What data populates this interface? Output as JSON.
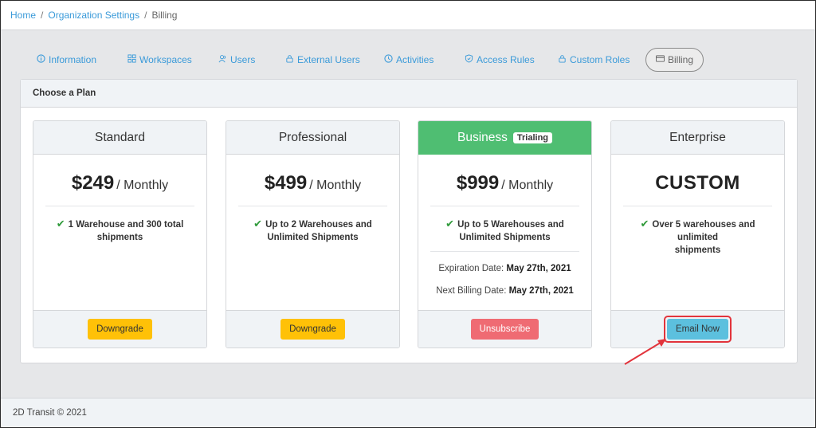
{
  "breadcrumb": {
    "items": [
      "Home",
      "Organization Settings"
    ],
    "separator": "/",
    "current": "Billing"
  },
  "tabs": [
    {
      "label": "Information",
      "icon": "info-icon"
    },
    {
      "label": "Workspaces",
      "icon": "grid-icon"
    },
    {
      "label": "Users",
      "icon": "users-icon"
    },
    {
      "label": "External Users",
      "icon": "lock-icon"
    },
    {
      "label": "Activities",
      "icon": "clock-icon"
    },
    {
      "label": "Access Rules",
      "icon": "shield-icon"
    },
    {
      "label": "Custom Roles",
      "icon": "lock-icon"
    },
    {
      "label": "Billing",
      "icon": "credit-card-icon",
      "active": true
    }
  ],
  "panel": {
    "title": "Choose a Plan"
  },
  "plans": [
    {
      "name": "Standard",
      "price": "$249",
      "period": "/ Monthly",
      "feature_line1": "1 Warehouse and 300 total",
      "feature_line2": "shipments",
      "button": "Downgrade"
    },
    {
      "name": "Professional",
      "price": "$499",
      "period": "/ Monthly",
      "feature_line1": "Up to 2 Warehouses and",
      "feature_line2": "Unlimited Shipments",
      "button": "Downgrade"
    },
    {
      "name": "Business",
      "badge": "Trialing",
      "price": "$999",
      "period": "/ Monthly",
      "feature_line1": "Up to 5 Warehouses and",
      "feature_line2": "Unlimited Shipments",
      "expiration_label": "Expiration Date:",
      "expiration_value": "May 27th, 2021",
      "next_billing_label": "Next Billing Date:",
      "next_billing_value": "May 27th, 2021",
      "button": "Unsubscribe"
    },
    {
      "name": "Enterprise",
      "price": "CUSTOM",
      "feature_line1": "Over 5 warehouses and unlimited",
      "feature_line2": "shipments",
      "button": "Email Now"
    }
  ],
  "footer": {
    "text": "2D Transit © 2021"
  },
  "colors": {
    "link": "#3a9ad9",
    "business_header": "#4fbe72",
    "downgrade": "#ffc107",
    "unsubscribe": "#ef6b73",
    "email_now": "#5cc0de",
    "highlight": "#e2343c"
  }
}
